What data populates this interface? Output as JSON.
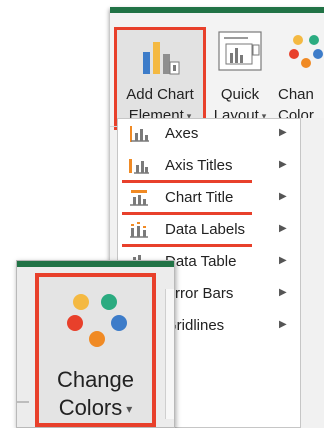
{
  "ribbon": {
    "add_chart": {
      "line1": "Add Chart",
      "line2": "Element",
      "icon": "add-chart-element-icon"
    },
    "quick": {
      "line1": "Quick",
      "line2": "Layout",
      "icon": "quick-layout-icon"
    },
    "change_partial": {
      "line1": "Chan",
      "line2": "Color"
    }
  },
  "menu": {
    "items": [
      {
        "label": "Axes",
        "icon": "axes-icon",
        "highlighted": false
      },
      {
        "label": "Axis Titles",
        "icon": "axis-titles-icon",
        "highlighted": true
      },
      {
        "label": "Chart Title",
        "icon": "chart-title-icon",
        "highlighted": true
      },
      {
        "label": "Data Labels",
        "icon": "data-labels-icon",
        "highlighted": true
      },
      {
        "label": "Data Table",
        "icon": "data-table-icon",
        "highlighted": false
      },
      {
        "label": "Error Bars",
        "icon": "error-bars-icon",
        "highlighted": false
      },
      {
        "label": "Gridlines",
        "icon": "gridlines-icon",
        "highlighted": false
      }
    ]
  },
  "inset": {
    "line1": "Change",
    "line2": "Colors",
    "icon": "change-colors-icon"
  },
  "colors": {
    "highlight": "#e8402b",
    "excel_green": "#217346",
    "dot_yellow": "#f4b942",
    "dot_teal": "#2bab80",
    "dot_red": "#e8402b",
    "dot_blue": "#3d7cc9",
    "dot_orange": "#f08a24"
  }
}
